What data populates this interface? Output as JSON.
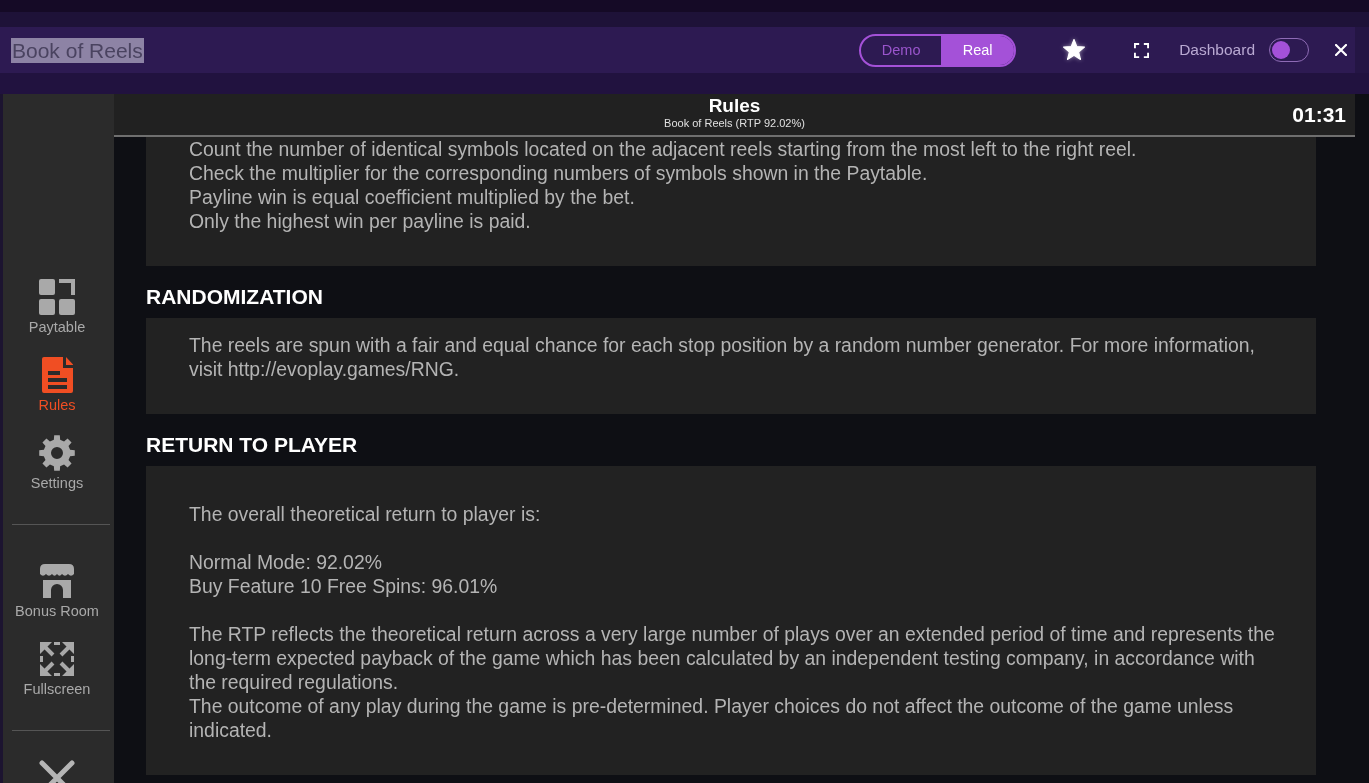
{
  "window": {
    "title": "Book of Reels",
    "title_highlighted": true
  },
  "mode_toggle": [
    {
      "label": "Demo",
      "selected": false
    },
    {
      "label": "Real",
      "selected": true
    }
  ],
  "dashboard": {
    "label": "Dashboard",
    "on": false
  },
  "sidebar": {
    "groups": [
      {
        "items": [
          {
            "label": "Paytable",
            "selected": false
          },
          {
            "label": "Rules",
            "selected": true
          },
          {
            "label": "Settings",
            "selected": false
          }
        ]
      },
      {
        "items": [
          {
            "label": "Bonus Room",
            "selected": false
          },
          {
            "label": "Fullscreen",
            "selected": false
          }
        ]
      }
    ]
  },
  "page_header": {
    "title": "Rules",
    "subtitle": "Book of Reels (RTP 92.02%)",
    "timer": "01:31"
  },
  "sections": [
    {
      "blocks": [
        [
          "Count the number of identical symbols located on the adjacent reels starting from the most left to the right reel.",
          "Check the multiplier for the corresponding numbers of symbols shown in the Paytable.",
          "Payline win is equal coefficient multiplied by the bet.",
          "Only the highest win per payline is paid."
        ]
      ]
    },
    {
      "heading": "RANDOMIZATION",
      "blocks": [
        [
          "The reels are spun with a fair and equal chance for each stop position by a random number generator. For more information, visit http://evoplay.games/RNG."
        ]
      ]
    },
    {
      "heading": "RETURN TO PLAYER",
      "blocks": [
        [
          "The overall theoretical return to player is:"
        ],
        [
          "Normal Mode: 92.02%",
          "Buy Feature 10 Free Spins: 96.01%"
        ],
        [
          "The RTP reflects the theoretical return across a very large number of plays over an extended period of time and represents the long-term expected payback of the game which has been calculated by an independent testing company, in accordance with the required regulations.",
          "The outcome of any play during the game is pre-determined. Player choices do not affect the outcome of the game unless indicated."
        ]
      ]
    }
  ]
}
